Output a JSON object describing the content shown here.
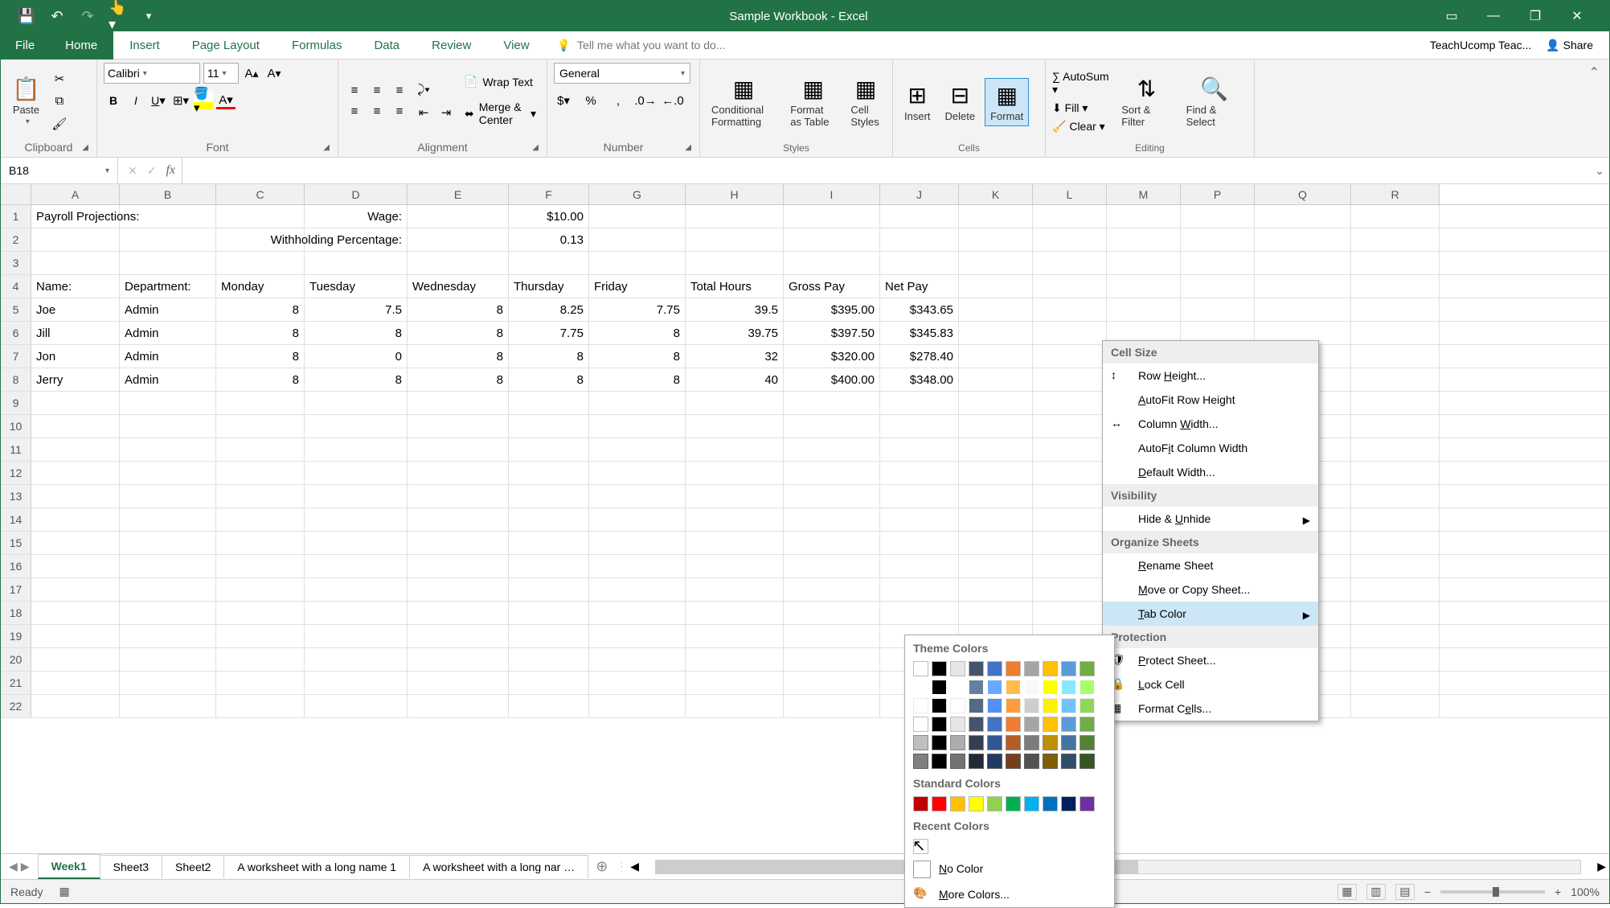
{
  "title": "Sample Workbook - Excel",
  "user": "TeachUcomp Teac...",
  "share": "Share",
  "qat": {
    "save": "💾",
    "undo": "↶",
    "redo": "↷",
    "touch": "👆"
  },
  "tabs": [
    "File",
    "Home",
    "Insert",
    "Page Layout",
    "Formulas",
    "Data",
    "Review",
    "View"
  ],
  "active_tab": "Home",
  "tellme": "Tell me what you want to do...",
  "ribbon": {
    "clipboard": {
      "label": "Clipboard",
      "paste": "Paste",
      "cut": "✂",
      "copy": "⧉",
      "painter": "🖌"
    },
    "font": {
      "label": "Font",
      "name": "Calibri",
      "size": "11"
    },
    "alignment": {
      "label": "Alignment",
      "wrap": "Wrap Text",
      "merge": "Merge & Center"
    },
    "number": {
      "label": "Number",
      "format": "General"
    },
    "styles": {
      "label": "Styles",
      "cf": "Conditional Formatting",
      "fat": "Format as Table",
      "cs": "Cell Styles"
    },
    "cells": {
      "label": "Cells",
      "insert": "Insert",
      "delete": "Delete",
      "format": "Format"
    },
    "editing": {
      "label": "Editing",
      "autosum": "AutoSum",
      "fill": "Fill",
      "clear": "Clear",
      "sort": "Sort & Filter",
      "find": "Find & Select"
    }
  },
  "namebox": "B18",
  "columns": [
    "A",
    "B",
    "C",
    "D",
    "E",
    "F",
    "G",
    "H",
    "I",
    "J",
    "K",
    "L",
    "M",
    "P",
    "Q",
    "R"
  ],
  "sheet": {
    "r1": {
      "A": "Payroll Projections:",
      "D": "Wage:",
      "F": "$10.00"
    },
    "r2": {
      "D": "Withholding Percentage:",
      "F": "0.13"
    },
    "r4": {
      "A": "Name:",
      "B": "Department:",
      "C": "Monday",
      "D": "Tuesday",
      "E": "Wednesday",
      "F": "Thursday",
      "G": "Friday",
      "H": "Total Hours",
      "I": "Gross Pay",
      "J": "Net Pay"
    },
    "r5": {
      "A": "Joe",
      "B": "Admin",
      "C": "8",
      "D": "7.5",
      "E": "8",
      "F": "8.25",
      "G": "7.75",
      "H": "39.5",
      "I": "$395.00",
      "J": "$343.65"
    },
    "r6": {
      "A": "Jill",
      "B": "Admin",
      "C": "8",
      "D": "8",
      "E": "8",
      "F": "7.75",
      "G": "8",
      "H": "39.75",
      "I": "$397.50",
      "J": "$345.83"
    },
    "r7": {
      "A": "Jon",
      "B": "Admin",
      "C": "8",
      "D": "0",
      "E": "8",
      "F": "8",
      "G": "8",
      "H": "32",
      "I": "$320.00",
      "J": "$278.40"
    },
    "r8": {
      "A": "Jerry",
      "B": "Admin",
      "C": "8",
      "D": "8",
      "E": "8",
      "F": "8",
      "G": "8",
      "H": "40",
      "I": "$400.00",
      "J": "$348.00"
    }
  },
  "format_menu": {
    "cellsize": "Cell Size",
    "rowheight": "Row Height...",
    "autofitr": "AutoFit Row Height",
    "colwidth": "Column Width...",
    "autofitc": "AutoFit Column Width",
    "defwidth": "Default Width...",
    "visibility": "Visibility",
    "hideunhide": "Hide & Unhide",
    "organize": "Organize Sheets",
    "rename": "Rename Sheet",
    "movecopy": "Move or Copy Sheet...",
    "tabcolor": "Tab Color",
    "protection": "Protection",
    "protectsheet": "Protect Sheet...",
    "lockcell": "Lock Cell",
    "formatcells": "Format Cells..."
  },
  "color_menu": {
    "theme": "Theme Colors",
    "standard": "Standard Colors",
    "recent": "Recent Colors",
    "nocolor": "No Color",
    "morecolors": "More Colors...",
    "theme_row": [
      "#FFFFFF",
      "#000000",
      "#EEECE1",
      "#1F497D",
      "#4F81BD",
      "#C0504D",
      "#9BBB59",
      "#F79646",
      "#4BACC6",
      "#8064A2"
    ],
    "theme_row_alt": [
      "#FFFFFF",
      "#000000",
      "#E7E6E6",
      "#44546A",
      "#4472C4",
      "#ED7D31",
      "#A5A5A5",
      "#FFC000",
      "#5B9BD5",
      "#70AD47"
    ],
    "standard_row": [
      "#C00000",
      "#FF0000",
      "#FFC000",
      "#FFFF00",
      "#92D050",
      "#00B050",
      "#00B0F0",
      "#0070C0",
      "#002060",
      "#7030A0"
    ],
    "recent_row": [
      "#FFFFFF"
    ]
  },
  "sheet_tabs": [
    "Week1",
    "Sheet3",
    "Sheet2",
    "A worksheet with a long name 1",
    "A worksheet with a long nar …"
  ],
  "active_sheet": "Week1",
  "status": "Ready",
  "zoom": "100%"
}
